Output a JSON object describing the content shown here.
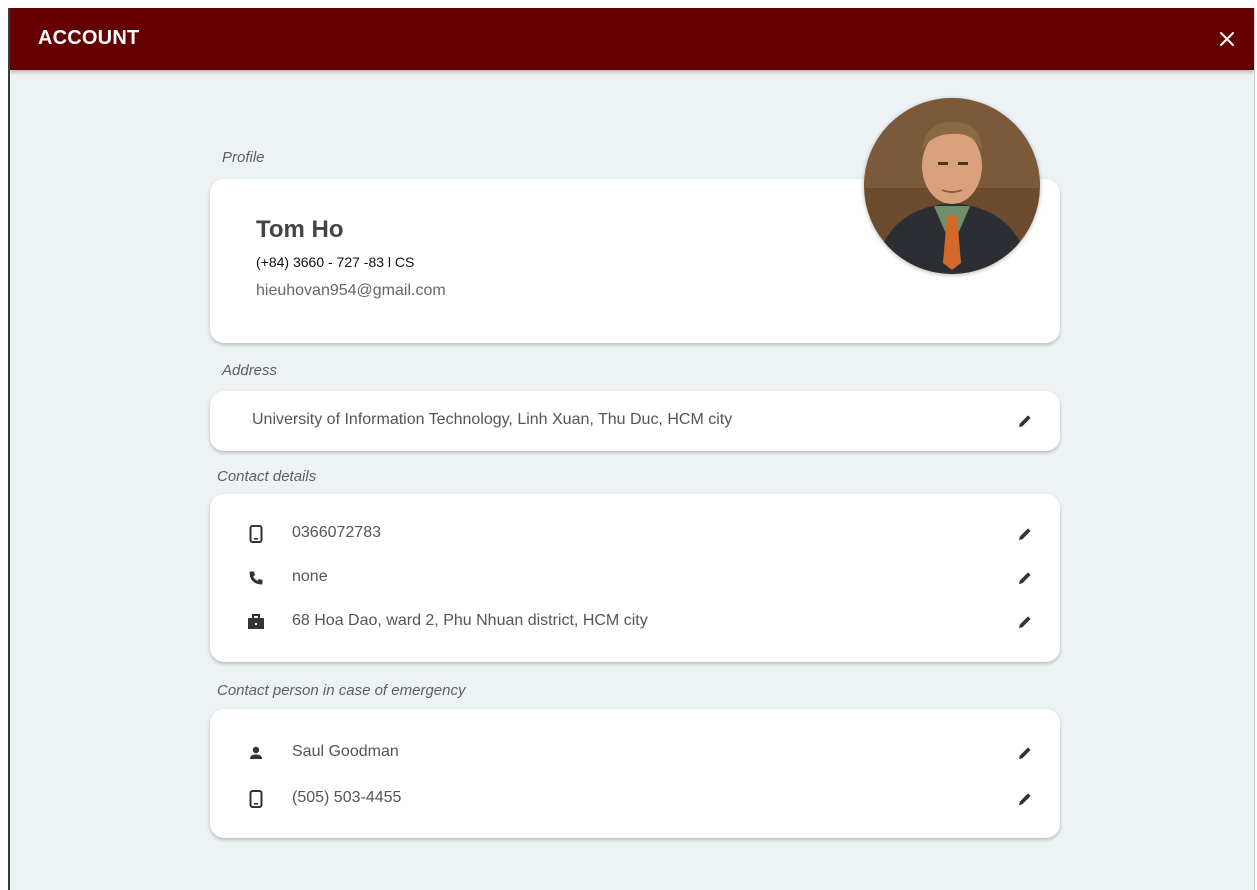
{
  "appbar": {
    "title": "ACCOUNT",
    "close_icon": "close-icon",
    "background": "#650000"
  },
  "profile": {
    "section_label": "Profile",
    "name": "Tom Ho",
    "phone_line": "(+84) 3660 - 727 -83 l CS",
    "email": "hieuhovan954@gmail.com"
  },
  "address": {
    "section_label": "Address",
    "value": "University of Information Technology, Linh Xuan, Thu Duc, HCM city"
  },
  "contact": {
    "section_label": "Contact details",
    "items": [
      {
        "icon": "mobile-phone-icon",
        "value": "0366072783"
      },
      {
        "icon": "phone-icon",
        "value": "none"
      },
      {
        "icon": "work-briefcase-icon",
        "value": "68 Hoa Dao, ward 2, Phu Nhuan district, HCM city"
      }
    ]
  },
  "emergency": {
    "section_label": "Contact person in case of emergency",
    "items": [
      {
        "icon": "person-icon",
        "value": "Saul Goodman"
      },
      {
        "icon": "mobile-phone-icon",
        "value": "(505) 503-4455"
      }
    ]
  }
}
